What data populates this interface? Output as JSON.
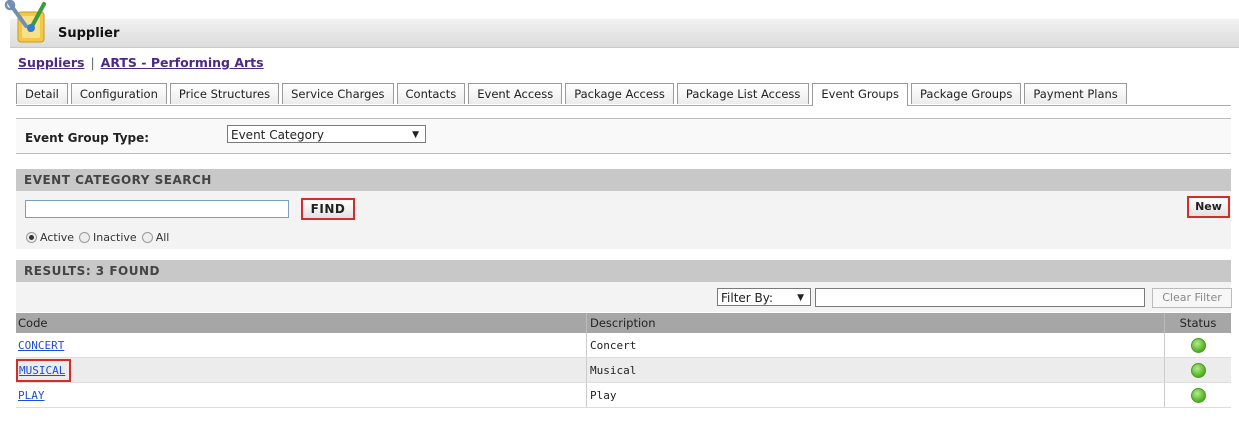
{
  "header": {
    "title": "Supplier",
    "logo_icon": "supplier-tools-icon"
  },
  "breadcrumb": {
    "root": "Suppliers",
    "separator": "|",
    "current": "ARTS - Performing Arts"
  },
  "tabs": [
    {
      "label": "Detail"
    },
    {
      "label": "Configuration"
    },
    {
      "label": "Price Structures"
    },
    {
      "label": "Service Charges"
    },
    {
      "label": "Contacts"
    },
    {
      "label": "Event Access"
    },
    {
      "label": "Package Access"
    },
    {
      "label": "Package List Access"
    },
    {
      "label": "Event Groups",
      "active": true
    },
    {
      "label": "Package Groups"
    },
    {
      "label": "Payment Plans"
    }
  ],
  "group_type": {
    "label": "Event Group Type:",
    "value": "Event Category"
  },
  "search": {
    "header": "EVENT CATEGORY SEARCH",
    "input_value": "",
    "find_label": "FIND",
    "new_label": "New",
    "radios": [
      {
        "label": "Active",
        "checked": true
      },
      {
        "label": "Inactive",
        "checked": false
      },
      {
        "label": "All",
        "checked": false
      }
    ]
  },
  "results": {
    "header": "RESULTS: 3 FOUND",
    "filter_by": "Filter By:",
    "filter_value": "",
    "clear_filter": "Clear Filter",
    "columns": {
      "code": "Code",
      "description": "Description",
      "status": "Status"
    },
    "rows": [
      {
        "code": "CONCERT",
        "description": "Concert",
        "status": "active"
      },
      {
        "code": "MUSICAL",
        "description": "Musical",
        "status": "active"
      },
      {
        "code": "PLAY",
        "description": "Play",
        "status": "active"
      }
    ]
  },
  "colors": {
    "highlight": "#d42b2b",
    "link": "#1a4fd6",
    "breadcrumb_link": "#4b2a86",
    "status_active": "#5cb82e"
  }
}
